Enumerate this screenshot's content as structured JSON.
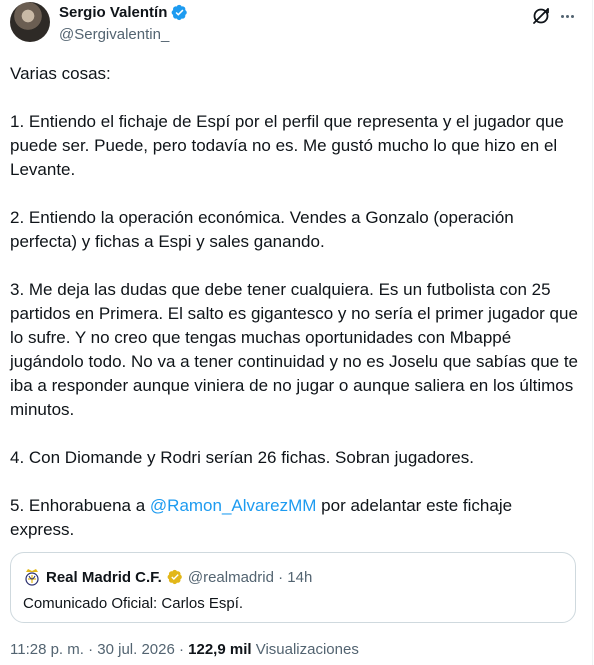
{
  "author": {
    "name": "Sergio Valentín",
    "handle": "@Sergivalentin_"
  },
  "tweet": {
    "intro": "Varias cosas:",
    "p1": "1. Entiendo el fichaje de Espí por el perfil que representa y el jugador que puede ser. Puede, pero todavía no es. Me gustó mucho lo que hizo en el Levante.",
    "p2": "2. Entiendo la operación económica. Vendes a Gonzalo (operación perfecta) y fichas a Espi y sales ganando.",
    "p3": "3. Me deja las dudas que debe tener cualquiera. Es un futbolista con 25 partidos en Primera. El salto es gigantesco y no sería el primer jugador que lo sufre. Y no creo que tengas muchas oportunidades con Mbappé jugándolo todo. No va a tener continuidad y no es Joselu que sabías que te iba a responder aunque viniera de no jugar o aunque saliera en los últimos minutos.",
    "p4": "4. Con Diomande y Rodri serían 26 fichas. Sobran jugadores.",
    "p5_before": "5. Enhorabuena a ",
    "p5_mention": "@Ramon_AlvarezMM",
    "p5_after": " por adelantar este fichaje express."
  },
  "quoted": {
    "name": "Real Madrid C.F.",
    "handle_time": "@realmadrid · 14h",
    "text": "Comunicado Oficial: Carlos Espí."
  },
  "meta": {
    "timestamp": "11:28 p. m. · 30 jul. 2026 · ",
    "views_count": "122,9 mil",
    "views_label": " Visualizaciones"
  },
  "icons": {
    "verified": "verified-badge-icon",
    "grok": "grok-icon",
    "more": "more-icon",
    "club_crest": "real-madrid-crest-icon",
    "gold_check": "gold-verified-icon"
  },
  "colors": {
    "accent": "#1d9bf0",
    "text": "#0f1419",
    "muted": "#536471",
    "border": "#cfd9de",
    "gold": "#e2b719"
  }
}
